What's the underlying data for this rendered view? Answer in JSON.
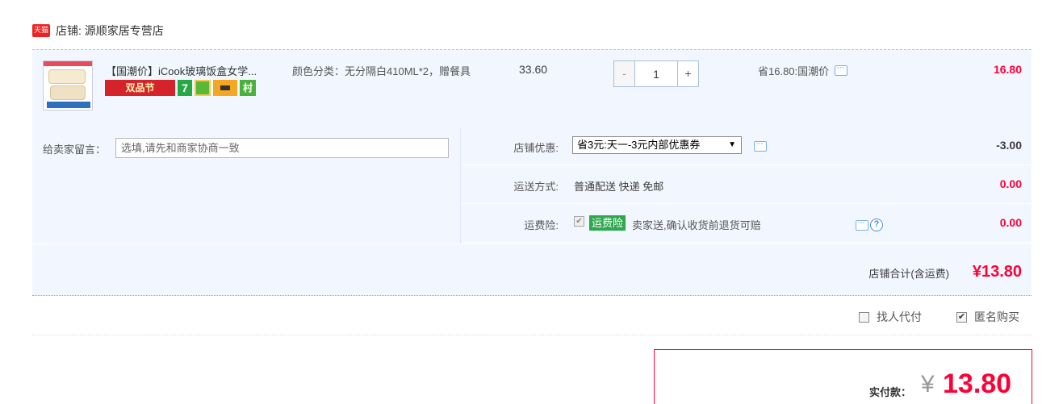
{
  "shop": {
    "badge_text": "天猫",
    "label": "店铺: 源顺家居专营店"
  },
  "item": {
    "thumbnail": "food-container-thumbnail",
    "title": "【国潮价】iCook玻璃饭盒女学...",
    "promo_icons": [
      {
        "name": "double-product-festival-badge",
        "text": "双品节"
      },
      {
        "name": "seven-day-return-icon",
        "text": "7"
      },
      {
        "name": "gift-icon",
        "text": ""
      },
      {
        "name": "credit-card-icon",
        "text": ""
      },
      {
        "name": "village-taobao-icon",
        "text": "村"
      }
    ],
    "sku": "颜色分类：无分隔白410ML*2，赠餐具",
    "unit_price": "33.60",
    "quantity": {
      "minus": "-",
      "value": "1",
      "plus": "+"
    },
    "saving": "省16.80:国潮价",
    "total": "16.80"
  },
  "message": {
    "label": "给卖家留言：",
    "placeholder": "选填,请先和商家协商一致",
    "value": ""
  },
  "options": {
    "shop_discount": {
      "label": "店铺优惠:",
      "selected": "省3元:天一-3元内部优惠券",
      "amount": "-3.00"
    },
    "shipping": {
      "label": "运送方式:",
      "value": "普通配送 快递 免邮",
      "amount": "0.00"
    },
    "insurance": {
      "label": "运费险:",
      "badge": "运费险",
      "text": "卖家送,确认收货前退货可赔",
      "amount": "0.00",
      "checked": true
    }
  },
  "shop_total": {
    "label": "店铺合计(含运费)",
    "value": "¥13.80"
  },
  "extras": {
    "proxy_pay_label": "找人代付",
    "proxy_pay_checked": false,
    "anonymous_label": "匿名购买",
    "anonymous_checked": true
  },
  "payment": {
    "label": "实付款：",
    "currency": "¥",
    "value": "13.80"
  },
  "colors": {
    "accent_red": "#ff0036",
    "panel_blue": "#f2f7ff",
    "insurance_green": "#2ea84e"
  }
}
